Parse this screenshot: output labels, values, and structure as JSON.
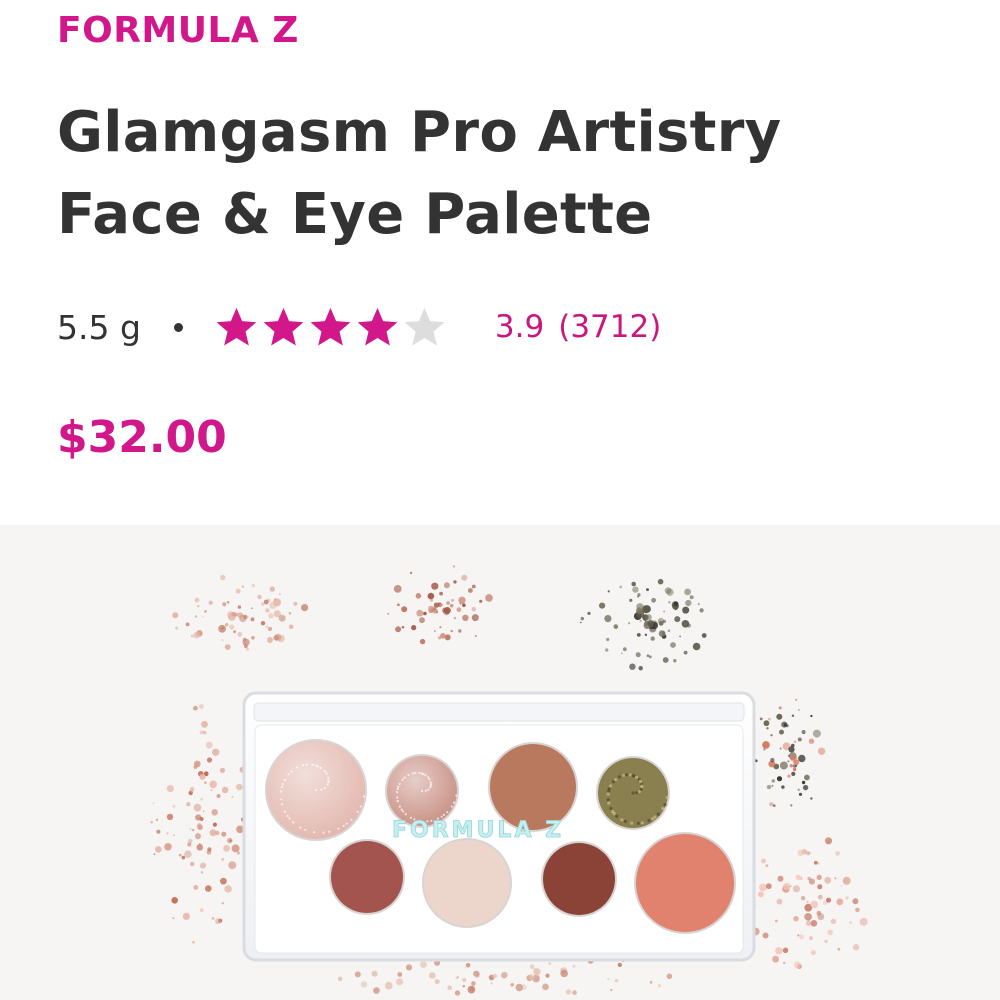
{
  "product": {
    "brand": "FORMULA Z",
    "title_line1": "Glamgasm Pro Artistry",
    "title_line2": "Face & Eye Palette",
    "size": "5.5 g",
    "rating": 3.9,
    "rating_text": "3.9",
    "review_count": "(3712)",
    "price": "$32.00"
  },
  "image": {
    "logo_text": "FORMULA Z",
    "pans": [
      {
        "color": "#e2b7ae",
        "type": "shimmer"
      },
      {
        "color": "#c89084",
        "type": "shimmer"
      },
      {
        "color": "#b9795f",
        "type": "matte"
      },
      {
        "color": "#8a7f4f",
        "type": "glitter"
      },
      {
        "color": "#a4544f",
        "type": "matte"
      },
      {
        "color": "#ecd6cc",
        "type": "matte"
      },
      {
        "color": "#8b4338",
        "type": "matte"
      },
      {
        "color": "#e1826f",
        "type": "matte"
      }
    ]
  },
  "colors": {
    "accent": "#d1178a",
    "text": "#333333",
    "star_filled": "#d1178a",
    "star_empty": "#dddddd"
  }
}
